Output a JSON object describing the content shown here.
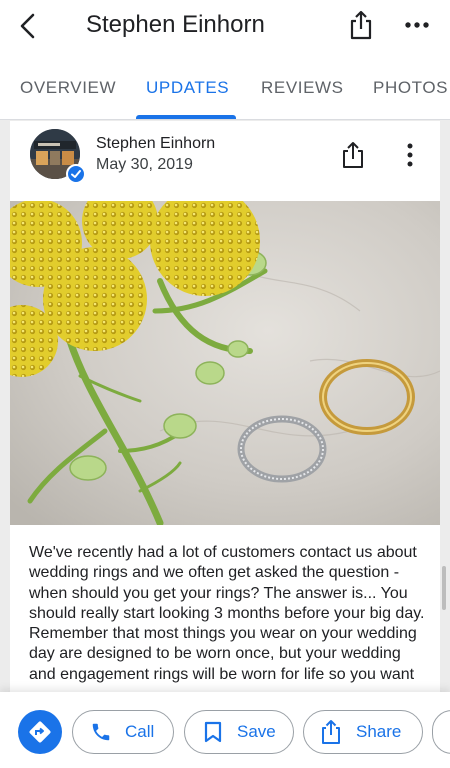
{
  "header": {
    "title": "Stephen Einhorn",
    "back_icon": "chevron-left-icon",
    "share_icon": "share-icon",
    "more_icon": "more-horizontal-icon"
  },
  "tabs": [
    {
      "label": "OVERVIEW",
      "active": false
    },
    {
      "label": "UPDATES",
      "active": true
    },
    {
      "label": "REVIEWS",
      "active": false
    },
    {
      "label": "PHOTOS",
      "active": false
    }
  ],
  "post": {
    "author": "Stephen Einhorn",
    "date": "May 30, 2019",
    "verified": true,
    "text": "We've recently had a lot of customers contact us about wedding rings and we often get asked the question - when should you get your rings? The answer is...  You should really start looking 3 months before your big day. Remember that most things you wear on your wedding day are designed to be worn once, but your wedding and engagement rings will be worn for life so you want"
  },
  "actions": {
    "directions_icon": "directions-icon",
    "call_label": "Call",
    "save_label": "Save",
    "share_label": "Share"
  },
  "colors": {
    "accent": "#1a73e8",
    "text": "#202124",
    "muted": "#5f6368"
  }
}
